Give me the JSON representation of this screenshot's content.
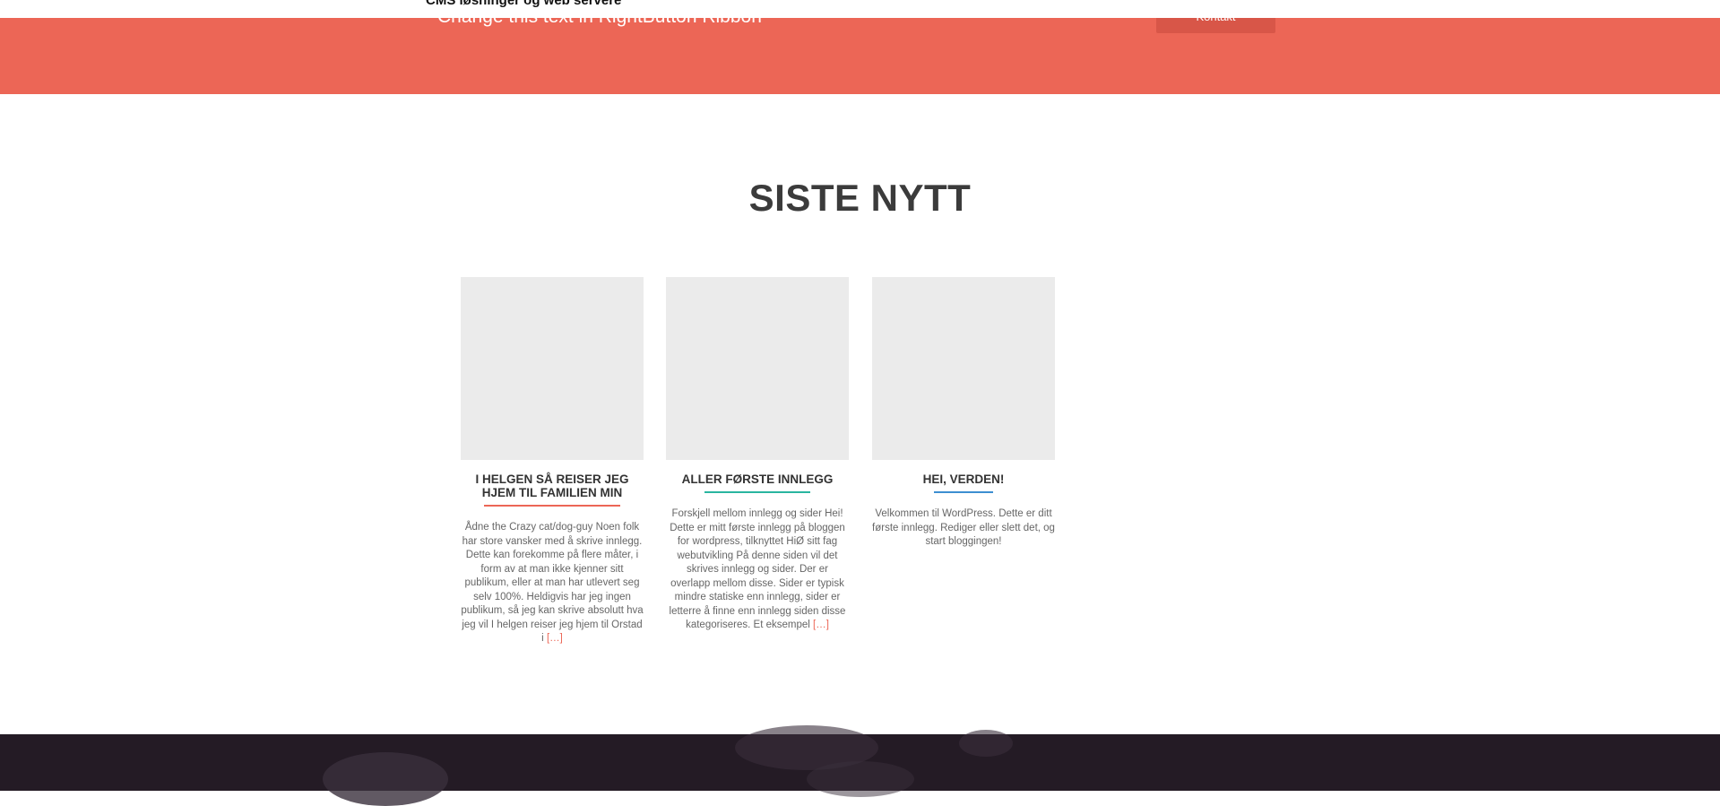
{
  "header": {
    "site_title": "CMS løsninger og web servere"
  },
  "ribbon": {
    "text": "Change this text in RightButton Ribbon",
    "button_label": "Kontakt",
    "color": "#ec6656"
  },
  "section": {
    "title": "SISTE NYTT"
  },
  "posts": [
    {
      "title": "I HELGEN SÅ REISER JEG HJEM TIL FAMILIEN MIN",
      "underline_color": "#ec6656",
      "excerpt": "Ådne the Crazy cat/dog-guy   Noen folk har store vansker med å skrive innlegg. Dette kan forekomme på flere måter, i form  av at man ikke kjenner sitt publikum, eller at man har utlevert seg selv 100%. Heldigvis har jeg ingen publikum, så jeg kan skrive absolutt hva jeg vil   I helgen reiser jeg hjem til Orstad i",
      "more": "[…]"
    },
    {
      "title": "ALLER FØRSTE INNLEGG",
      "underline_color": "#2ab5a0",
      "excerpt": "Forskjell mellom innlegg og sider Hei! Dette er mitt første innlegg på bloggen for wordpress, tilknyttet HiØ sitt fag webutvikling   På denne siden vil det skrives innlegg og sider. Der er overlapp mellom disse. Sider er typisk mindre statiske enn innlegg, sider er letterre å finne enn innlegg siden disse kategoriseres.   Et eksempel",
      "more": "[…]"
    },
    {
      "title": "HEI, VERDEN!",
      "underline_color": "#3d8fd1",
      "excerpt": "Velkommen til WordPress. Dette er ditt første innlegg. Rediger eller slett det, og start bloggingen!",
      "more": ""
    }
  ]
}
